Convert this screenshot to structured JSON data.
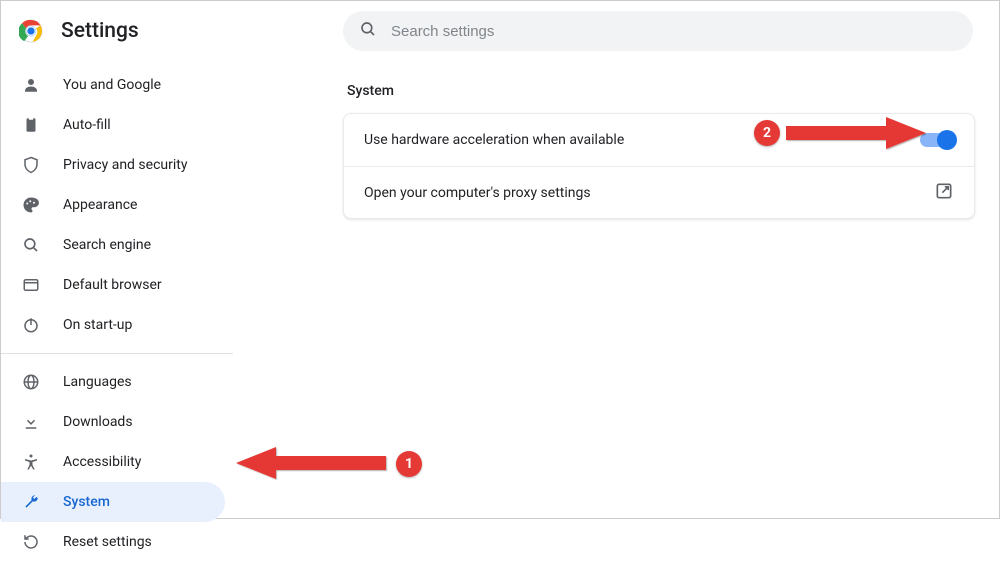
{
  "header": {
    "title": "Settings",
    "search_placeholder": "Search settings"
  },
  "sidebar": {
    "groups": [
      [
        {
          "icon": "person",
          "label": "You and Google"
        },
        {
          "icon": "clipboard",
          "label": "Auto-fill"
        },
        {
          "icon": "shield",
          "label": "Privacy and security"
        },
        {
          "icon": "palette",
          "label": "Appearance"
        },
        {
          "icon": "search",
          "label": "Search engine"
        },
        {
          "icon": "browser",
          "label": "Default browser"
        },
        {
          "icon": "power",
          "label": "On start-up"
        }
      ],
      [
        {
          "icon": "globe",
          "label": "Languages"
        },
        {
          "icon": "download",
          "label": "Downloads"
        },
        {
          "icon": "accessibility",
          "label": "Accessibility"
        },
        {
          "icon": "wrench",
          "label": "System",
          "selected": true
        },
        {
          "icon": "reset",
          "label": "Reset settings"
        }
      ]
    ]
  },
  "section": {
    "title": "System",
    "rows": [
      {
        "label": "Use hardware acceleration when available",
        "control": "toggle",
        "toggle_on": true
      },
      {
        "label": "Open your computer's proxy settings",
        "control": "external"
      }
    ]
  },
  "annotations": {
    "badge1": "1",
    "badge2": "2",
    "arrow_color": "#e53935"
  }
}
